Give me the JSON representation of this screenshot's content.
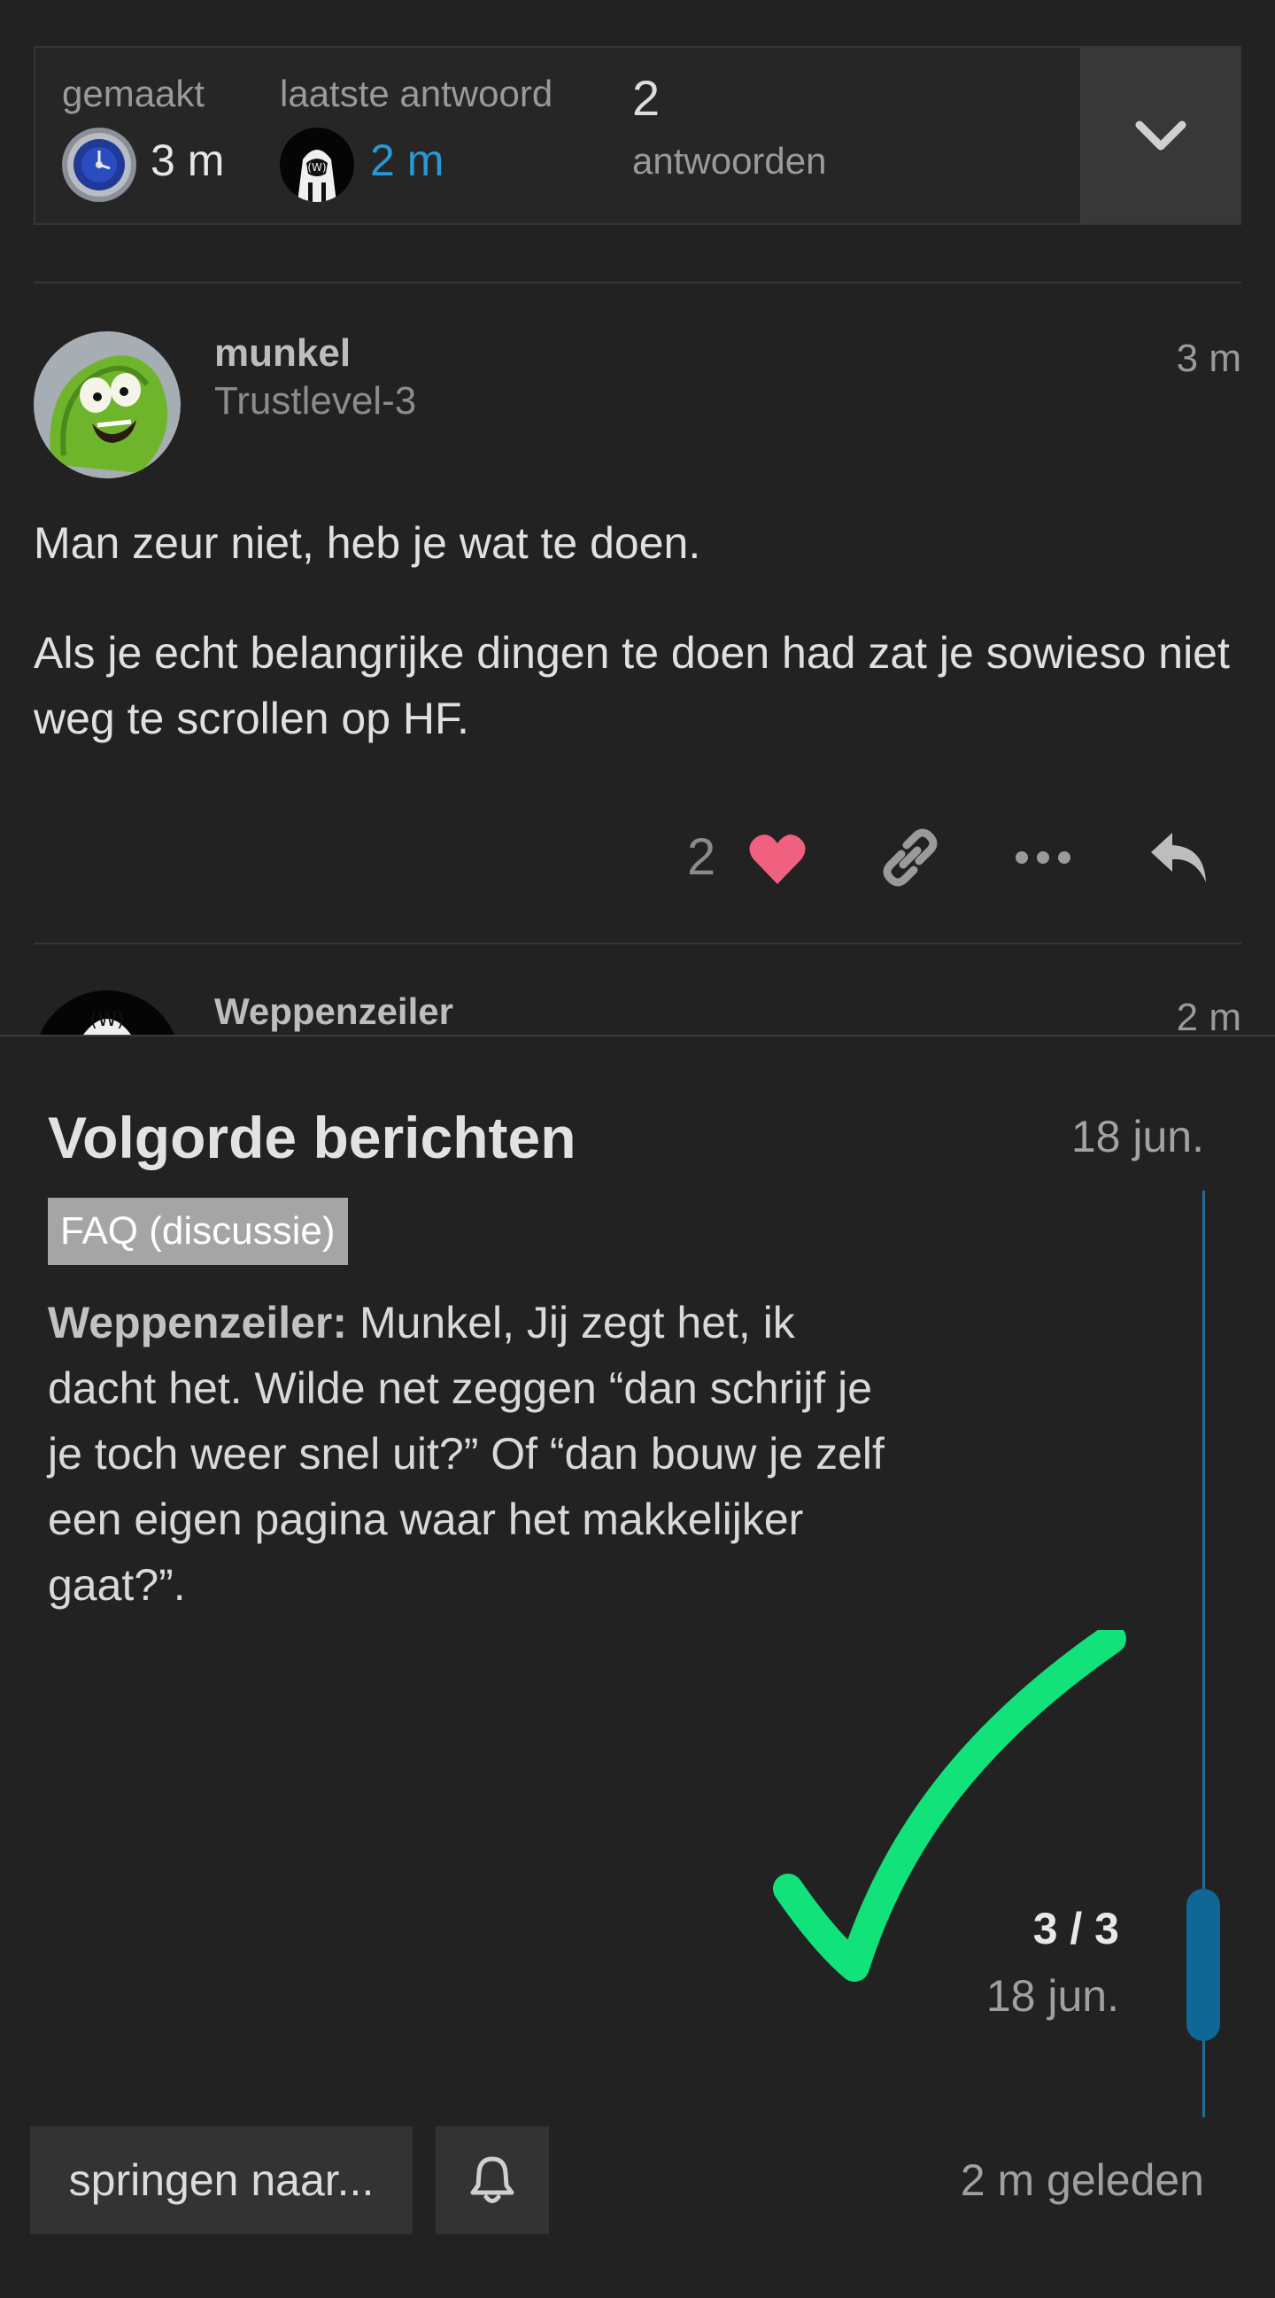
{
  "topic_map": {
    "created_label": "gemaakt",
    "created_time": "3 m",
    "last_reply_label": "laatste antwoord",
    "last_reply_time": "2 m",
    "replies_count": "2",
    "replies_label": "antwoorden"
  },
  "post1": {
    "username": "munkel",
    "user_title": "Trustlevel-3",
    "date": "3 m",
    "paragraphs": [
      "Man zeur niet, heb je wat te doen.",
      "Als je echt belangrijke dingen te doen had zat je sowieso niet weg te scrollen op HF."
    ],
    "like_count": "2"
  },
  "post2": {
    "username": "Weppenzeiler",
    "date": "2 m"
  },
  "timeline": {
    "title": "Volgorde berichten",
    "date_top": "18 jun.",
    "category": "FAQ (discussie)",
    "excerpt_author": "Weppenzeiler:",
    "excerpt_text": " Munkel, Jij zegt het, ik dacht het. Wilde net zeggen “dan schrijf je je toch weer snel uit?” Of “dan bouw je zelf een eigen pagina waar het makkelijker gaat?”.",
    "position": "3 / 3",
    "position_date": "18 jun.",
    "jump_button": "springen naar...",
    "ago": "2 m geleden"
  },
  "colors": {
    "background": "#222222",
    "link_blue": "#2a98d4",
    "like_pink": "#f0607f",
    "timeline_blue": "#0e6795",
    "check_green": "#12e27a"
  }
}
